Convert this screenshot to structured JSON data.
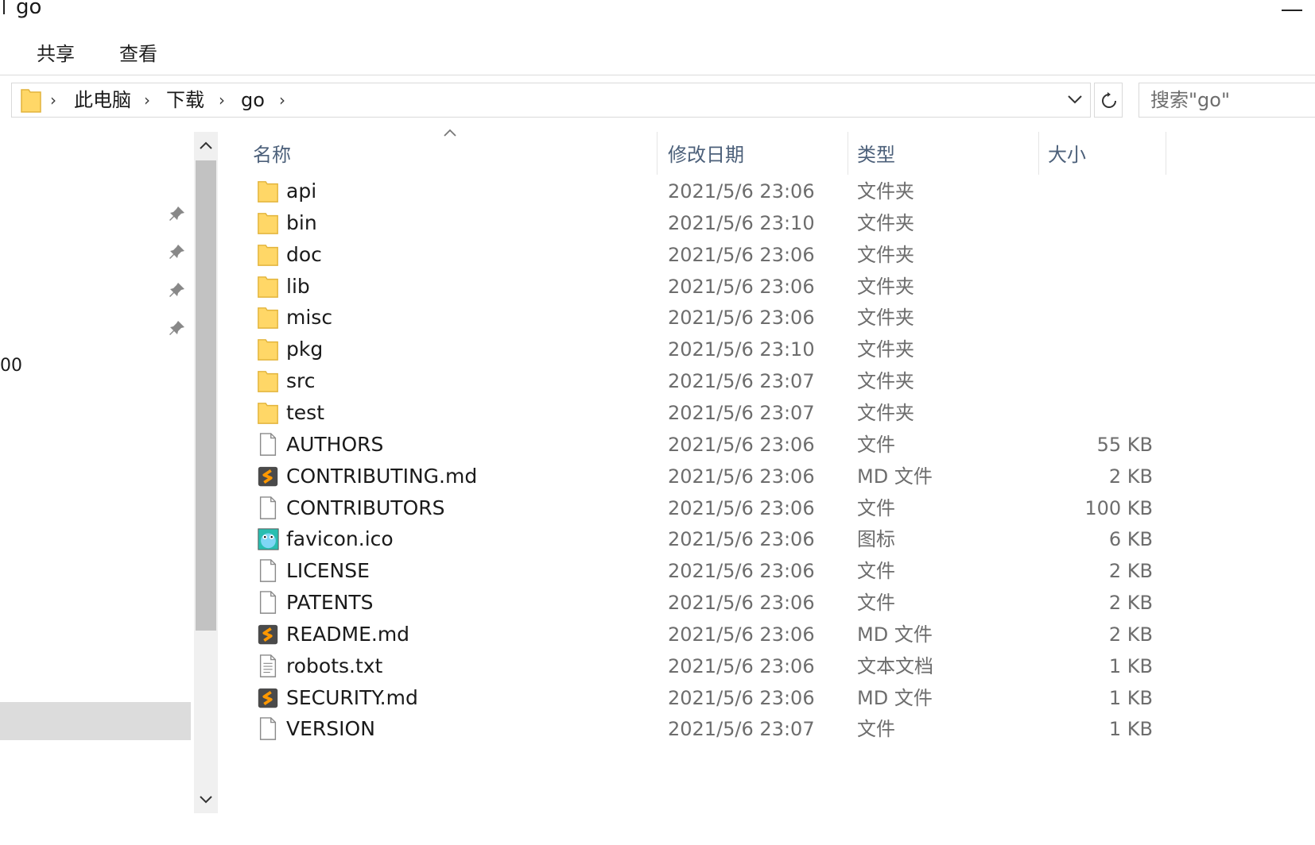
{
  "window": {
    "title": "go"
  },
  "ribbon": {
    "tabs": [
      {
        "label": "共享"
      },
      {
        "label": "查看"
      }
    ]
  },
  "address": {
    "folder_icon": "folder-icon",
    "crumbs": [
      {
        "label": "此电脑"
      },
      {
        "label": "下载"
      },
      {
        "label": "go"
      }
    ],
    "separator": "›"
  },
  "search": {
    "placeholder": "搜索\"go\""
  },
  "nav": {
    "fragment_text": "00",
    "pinned_count": 4
  },
  "columns": {
    "name": "名称",
    "date": "修改日期",
    "type": "类型",
    "size": "大小"
  },
  "files": [
    {
      "name": "api",
      "date": "2021/5/6 23:06",
      "type": "文件夹",
      "size": "",
      "icon": "folder"
    },
    {
      "name": "bin",
      "date": "2021/5/6 23:10",
      "type": "文件夹",
      "size": "",
      "icon": "folder"
    },
    {
      "name": "doc",
      "date": "2021/5/6 23:06",
      "type": "文件夹",
      "size": "",
      "icon": "folder"
    },
    {
      "name": "lib",
      "date": "2021/5/6 23:06",
      "type": "文件夹",
      "size": "",
      "icon": "folder"
    },
    {
      "name": "misc",
      "date": "2021/5/6 23:06",
      "type": "文件夹",
      "size": "",
      "icon": "folder"
    },
    {
      "name": "pkg",
      "date": "2021/5/6 23:10",
      "type": "文件夹",
      "size": "",
      "icon": "folder"
    },
    {
      "name": "src",
      "date": "2021/5/6 23:07",
      "type": "文件夹",
      "size": "",
      "icon": "folder"
    },
    {
      "name": "test",
      "date": "2021/5/6 23:07",
      "type": "文件夹",
      "size": "",
      "icon": "folder"
    },
    {
      "name": "AUTHORS",
      "date": "2021/5/6 23:06",
      "type": "文件",
      "size": "55 KB",
      "icon": "file"
    },
    {
      "name": "CONTRIBUTING.md",
      "date": "2021/5/6 23:06",
      "type": "MD 文件",
      "size": "2 KB",
      "icon": "md"
    },
    {
      "name": "CONTRIBUTORS",
      "date": "2021/5/6 23:06",
      "type": "文件",
      "size": "100 KB",
      "icon": "file"
    },
    {
      "name": "favicon.ico",
      "date": "2021/5/6 23:06",
      "type": "图标",
      "size": "6 KB",
      "icon": "ico"
    },
    {
      "name": "LICENSE",
      "date": "2021/5/6 23:06",
      "type": "文件",
      "size": "2 KB",
      "icon": "file"
    },
    {
      "name": "PATENTS",
      "date": "2021/5/6 23:06",
      "type": "文件",
      "size": "2 KB",
      "icon": "file"
    },
    {
      "name": "README.md",
      "date": "2021/5/6 23:06",
      "type": "MD 文件",
      "size": "2 KB",
      "icon": "md"
    },
    {
      "name": "robots.txt",
      "date": "2021/5/6 23:06",
      "type": "文本文档",
      "size": "1 KB",
      "icon": "txt"
    },
    {
      "name": "SECURITY.md",
      "date": "2021/5/6 23:06",
      "type": "MD 文件",
      "size": "1 KB",
      "icon": "md"
    },
    {
      "name": "VERSION",
      "date": "2021/5/6 23:07",
      "type": "文件",
      "size": "1 KB",
      "icon": "file"
    }
  ]
}
